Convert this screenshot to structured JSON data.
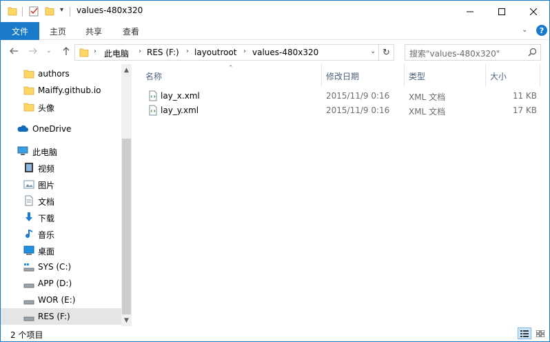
{
  "window": {
    "title": "values-480x320"
  },
  "ribbon": {
    "tabs": [
      {
        "label": "文件"
      },
      {
        "label": "主页"
      },
      {
        "label": "共享"
      },
      {
        "label": "查看"
      }
    ],
    "help": "?"
  },
  "address": {
    "crumbs": [
      "此电脑",
      "RES (F:)",
      "layoutroot",
      "values-480x320"
    ]
  },
  "search": {
    "placeholder": "搜索\"values-480x320\""
  },
  "nav_pane": {
    "items": [
      {
        "label": "authors",
        "icon": "folder-icon"
      },
      {
        "label": "Maiffy.github.io",
        "icon": "folder-icon"
      },
      {
        "label": "头像",
        "icon": "folder-icon"
      },
      {
        "label": "OneDrive",
        "icon": "cloud-icon"
      },
      {
        "label": "此电脑",
        "icon": "computer-icon"
      },
      {
        "label": "视频",
        "icon": "video-icon"
      },
      {
        "label": "图片",
        "icon": "picture-icon"
      },
      {
        "label": "文档",
        "icon": "document-icon"
      },
      {
        "label": "下载",
        "icon": "download-icon"
      },
      {
        "label": "音乐",
        "icon": "music-icon"
      },
      {
        "label": "桌面",
        "icon": "desktop-icon"
      },
      {
        "label": "SYS (C:)",
        "icon": "drive-icon"
      },
      {
        "label": "APP (D:)",
        "icon": "drive-icon"
      },
      {
        "label": "WOR (E:)",
        "icon": "drive-icon"
      },
      {
        "label": "RES (F:)",
        "icon": "drive-icon"
      }
    ],
    "selected": "RES (F:)"
  },
  "files": {
    "columns": {
      "name": "名称",
      "date": "修改日期",
      "type": "类型",
      "size": "大小"
    },
    "rows": [
      {
        "name": "lay_x.xml",
        "date": "2015/11/9 0:16",
        "type": "XML 文档",
        "size": "11 KB"
      },
      {
        "name": "lay_y.xml",
        "date": "2015/11/9 0:16",
        "type": "XML 文档",
        "size": "17 KB"
      }
    ]
  },
  "status": {
    "text": "2 个项目"
  },
  "colors": {
    "accent": "#1979ca",
    "folder": "#ffd767",
    "selected_bg": "#e5e5e5"
  }
}
